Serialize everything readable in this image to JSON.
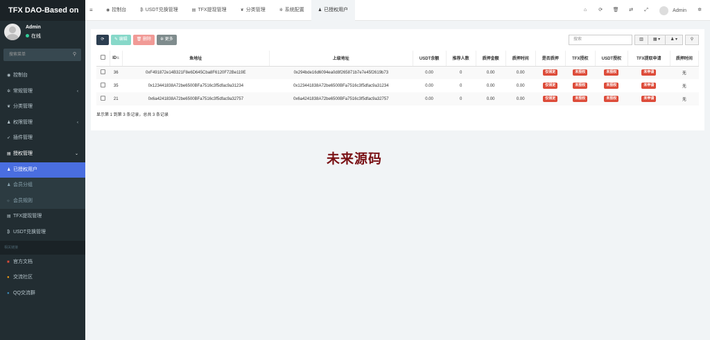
{
  "sidebar": {
    "logo": "TFX DAO-Based on",
    "user": {
      "name": "Admin",
      "status": "在线"
    },
    "search_placeholder": "搜索菜单",
    "items": [
      {
        "label": "控制台",
        "icon": "dashboard-icon",
        "glyph": "◉"
      },
      {
        "label": "常规管理",
        "icon": "cogs-icon",
        "glyph": "✲",
        "caret": "‹"
      },
      {
        "label": "分类管理",
        "icon": "leaf-icon",
        "glyph": "❦"
      },
      {
        "label": "权限管理",
        "icon": "group-icon",
        "glyph": "♟",
        "caret": "‹"
      },
      {
        "label": "插件管理",
        "icon": "rocket-icon",
        "glyph": "➶"
      },
      {
        "label": "授权管理",
        "icon": "list-icon",
        "glyph": "▤",
        "caret": "⌄"
      }
    ],
    "subitems": [
      {
        "label": "已授权用户",
        "icon": "user-icon",
        "glyph": "♟"
      },
      {
        "label": "会员分组",
        "icon": "users-icon",
        "glyph": "♟"
      },
      {
        "label": "会员规则",
        "icon": "circle-icon",
        "glyph": "○"
      }
    ],
    "items2": [
      {
        "label": "TFX提现管理",
        "icon": "list-alt-icon",
        "glyph": "▤"
      },
      {
        "label": "USDT兑换管理",
        "icon": "bitcoin-icon",
        "glyph": "₿"
      }
    ],
    "header": "相关链接",
    "links": [
      {
        "label": "官方文档",
        "icon": "book-icon",
        "glyph": "■",
        "color": "#dd4b39"
      },
      {
        "label": "交流社区",
        "icon": "comment-icon",
        "glyph": "●",
        "color": "#f39c12"
      },
      {
        "label": "QQ交流群",
        "icon": "qq-icon",
        "glyph": "●",
        "color": "#3c8dbc"
      }
    ]
  },
  "topbar": {
    "toggle_icon": "≡",
    "tabs": [
      {
        "label": "控制台",
        "glyph": "◉",
        "icon": "dashboard-icon"
      },
      {
        "label": "USDT兑换管理",
        "glyph": "₿",
        "icon": "bitcoin-icon"
      },
      {
        "label": "TFX提现管理",
        "glyph": "▤",
        "icon": "list-alt-icon"
      },
      {
        "label": "分类管理",
        "glyph": "❦",
        "icon": "leaf-icon"
      },
      {
        "label": "系统配置",
        "glyph": "✲",
        "icon": "cog-icon"
      },
      {
        "label": "已授权用户",
        "glyph": "♟",
        "icon": "user-icon"
      }
    ],
    "right_icons": [
      {
        "glyph": "⌂",
        "icon": "home-icon"
      },
      {
        "glyph": "⟳",
        "icon": "refresh-icon"
      },
      {
        "glyph": "🗑",
        "icon": "trash-icon"
      },
      {
        "glyph": "⇄",
        "icon": "translate-icon"
      },
      {
        "glyph": "⤢",
        "icon": "fullscreen-icon"
      }
    ],
    "user": "Admin",
    "settings_glyph": "✲"
  },
  "toolbar": {
    "refresh": "⟳",
    "edit": "✎ 编辑",
    "delete": "🗑 删除",
    "more": "✲ 更多",
    "search_placeholder": "搜索",
    "view_glyph": "▥",
    "columns_glyph": "▦ ▾",
    "export_glyph": "♟ ▾",
    "search_glyph": "⚲"
  },
  "table": {
    "headers": [
      "ID",
      "鱼地址",
      "上级地址",
      "USDT余额",
      "推荐人数",
      "质押金额",
      "质押时间",
      "是否质押",
      "TFX授权",
      "USDT授权",
      "TFX提取申请",
      "质押时间"
    ],
    "sort_glyph": "⇅",
    "rows": [
      {
        "id": "36",
        "addr": "0xF491872e14B321F8e6D645Cba8F6120F72Be119E",
        "parent": "0x294bde16d6094ea0d8f265871b7e7e45f2619b73",
        "usdt": "0.00",
        "refs": "0",
        "stake": "0.00",
        "stake_time": "0.00",
        "staked": "仅领定",
        "tfx_auth": "未授权",
        "usdt_auth": "未授权",
        "tfx_apply": "未申请",
        "time": "无"
      },
      {
        "id": "35",
        "addr": "0x123441838A72be6500BFa7516c3f5dfac9a31234",
        "parent": "0x123441838A72be6500BFa7516c3f5dfac9a31234",
        "usdt": "0.00",
        "refs": "0",
        "stake": "0.00",
        "stake_time": "0.00",
        "staked": "仅领定",
        "tfx_auth": "未授权",
        "usdt_auth": "未授权",
        "tfx_apply": "未申请",
        "time": "无"
      },
      {
        "id": "21",
        "addr": "0x6a4241838A72be6500BFa7516c3f5dfac9a32757",
        "parent": "0x6a4241838A72be6500BFa7516c3f5dfac9a32757",
        "usdt": "0.00",
        "refs": "0",
        "stake": "0.00",
        "stake_time": "0.00",
        "staked": "仅领定",
        "tfx_auth": "未授权",
        "usdt_auth": "未授权",
        "tfx_apply": "未申请",
        "time": "无"
      }
    ]
  },
  "pager": "显示第 1 到第 3 条记录，总共 3 条记录",
  "watermark": "未来源码"
}
